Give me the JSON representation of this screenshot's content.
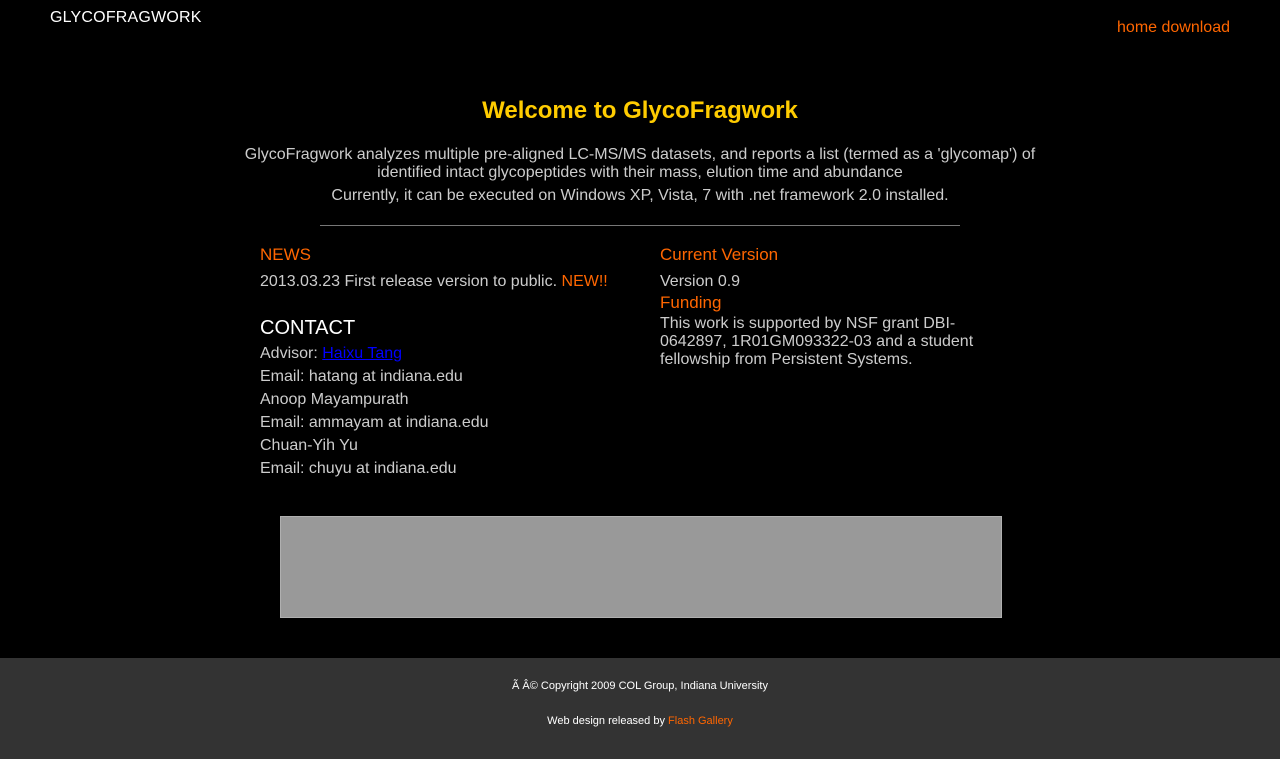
{
  "header": {
    "logo": "GLYCOFRAGWORK",
    "nav": [
      "home",
      "download"
    ]
  },
  "main": {
    "title": "Welcome to GlycoFragwork",
    "intro_line1": "GlycoFragwork analyzes multiple pre-aligned LC-MS/MS datasets, and reports a list (termed as a 'glycomap') of identified intact glycopeptides with their mass, elution time and abundance",
    "intro_line2": "Currently, it can be executed on Windows XP, Vista, 7 with .net framework 2.0 installed."
  },
  "news": {
    "heading": "NEWS",
    "item": "2013.03.23 First release version to public.",
    "flag": "NEW!!"
  },
  "contact": {
    "heading": "CONTACT",
    "advisor_label": "Advisor:",
    "advisor_name": "Haixu Tang",
    "lines": [
      "Email: hatang at indiana.edu",
      "Anoop Mayampurath",
      "Email: ammayam at indiana.edu",
      "Chuan-Yih Yu",
      "Email: chuyu at indiana.edu"
    ]
  },
  "version": {
    "heading": "Current Version",
    "text": "Version 0.9"
  },
  "funding": {
    "heading": "Funding",
    "text": "This work is supported by NSF grant DBI-0642897, 1R01GM093322-03 and a student fellowship from Persistent Systems."
  },
  "footer": {
    "copyright": "Ã   Â© Copyright 2009 COL Group, Indiana University",
    "credit_prefix": "Web design released by",
    "credit_link": "Flash Gallery"
  },
  "colors": {
    "accent": "#ff6600",
    "title": "#ffcc00",
    "link": "#0000ff",
    "footer_bg": "#333333",
    "banner_bg": "#999999"
  }
}
